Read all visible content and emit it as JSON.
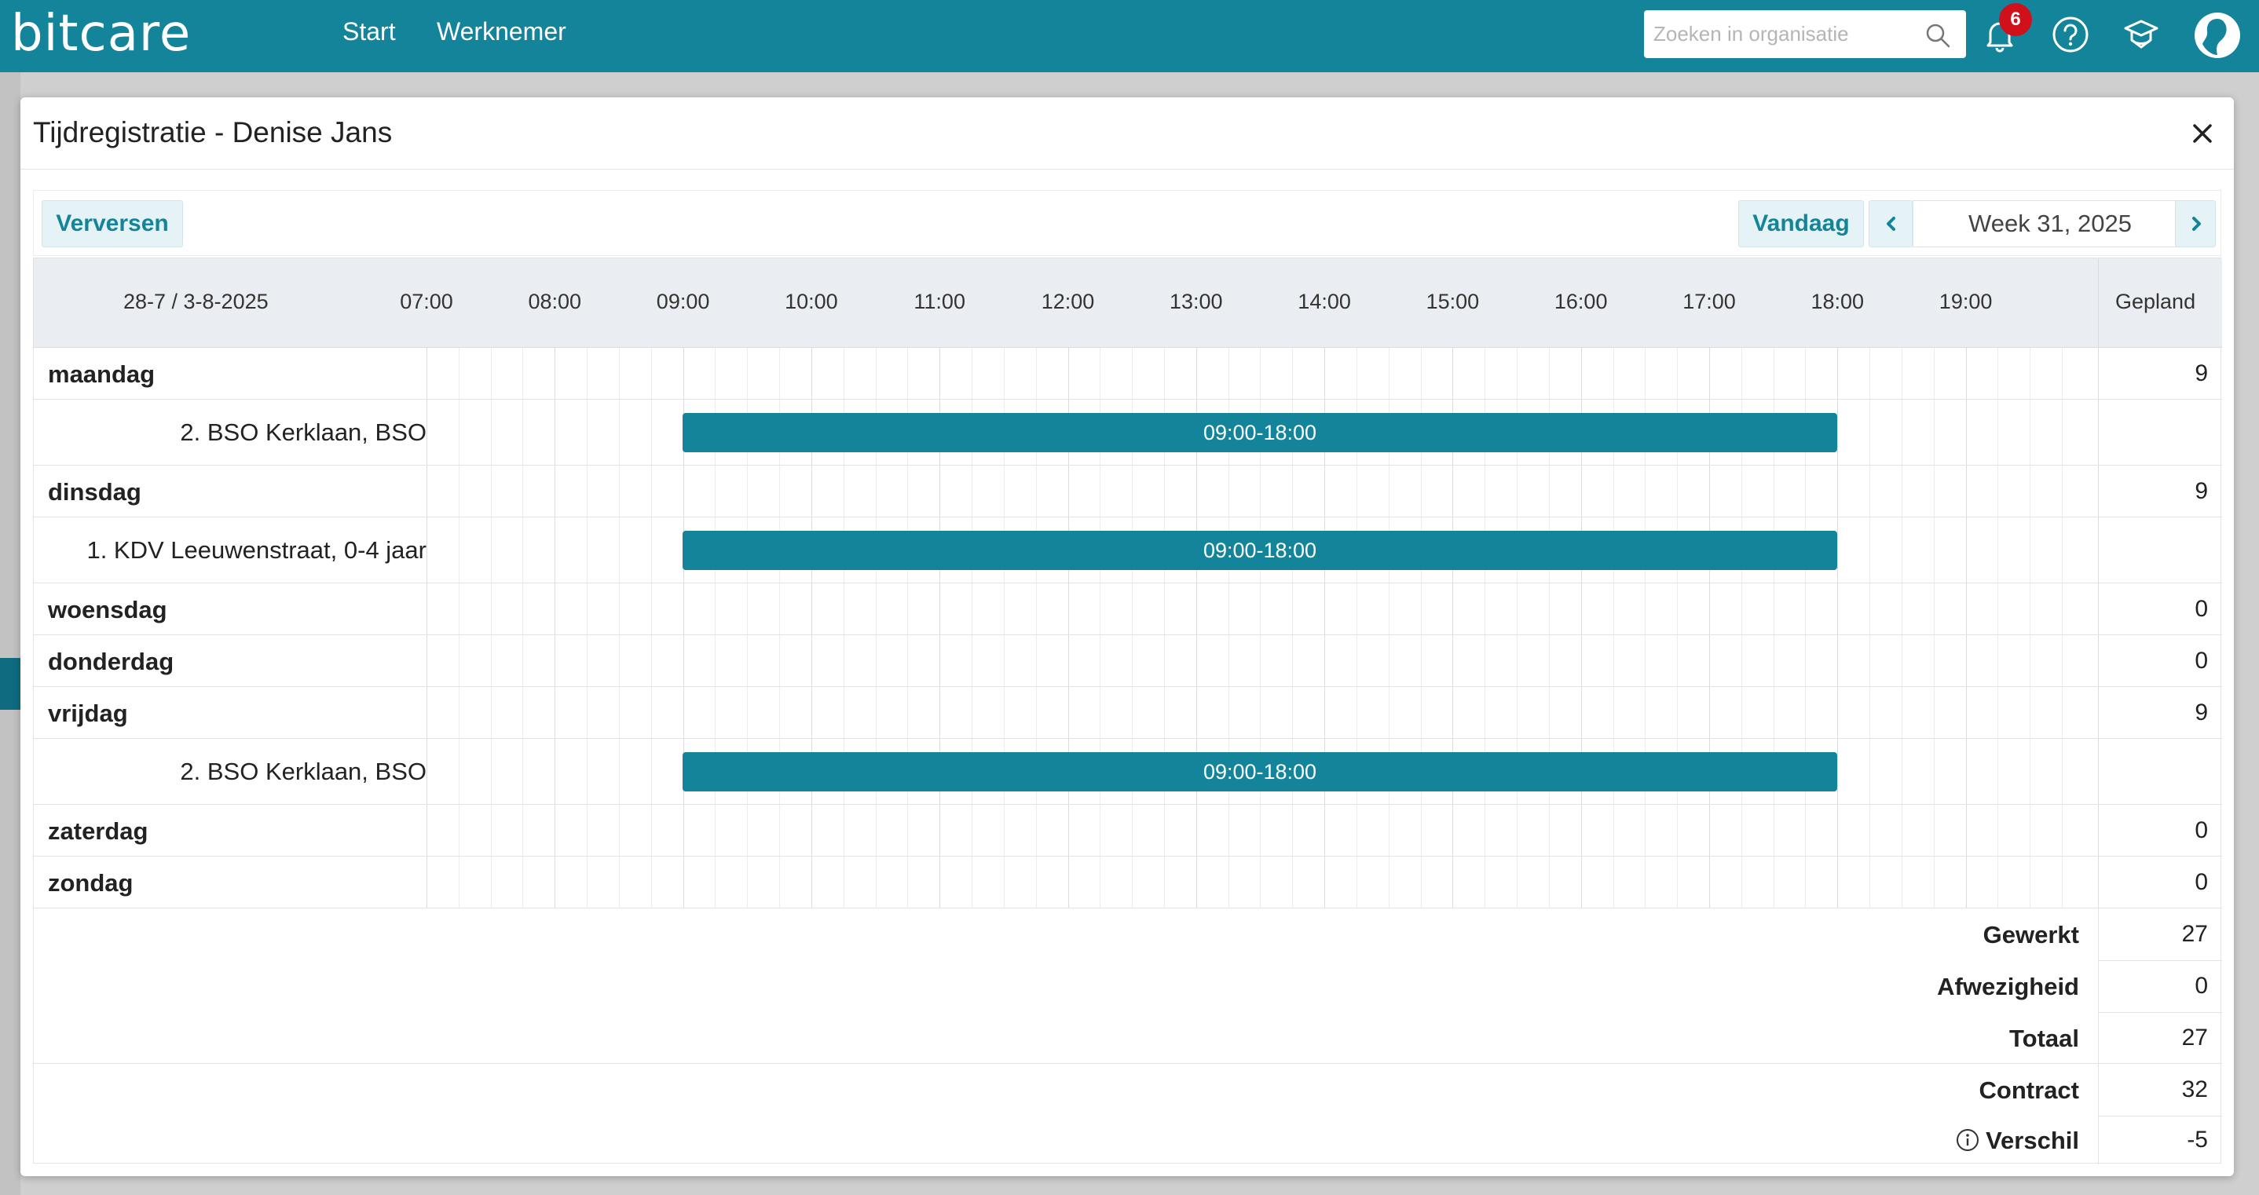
{
  "app": {
    "logo": "bitcare",
    "nav": [
      "Start",
      "Werknemer"
    ],
    "search_placeholder": "Zoeken in organisatie",
    "notification_count": "6",
    "accent_color": "#13849a"
  },
  "modal": {
    "title": "Tijdregistratie - Denise Jans",
    "refresh_label": "Verversen",
    "today_label": "Vandaag",
    "week_label": "Week 31, 2025"
  },
  "grid": {
    "date_range": "28-7 / 3-8-2025",
    "hours": [
      "07:00",
      "08:00",
      "09:00",
      "10:00",
      "11:00",
      "12:00",
      "13:00",
      "14:00",
      "15:00",
      "16:00",
      "17:00",
      "18:00",
      "19:00"
    ],
    "planned_header": "Gepland",
    "days": [
      {
        "name": "maandag",
        "planned": "9",
        "location": "2. BSO Kerklaan, BSO",
        "shift": "09:00-18:00"
      },
      {
        "name": "dinsdag",
        "planned": "9",
        "location": "1. KDV Leeuwenstraat, 0-4 jaar",
        "shift": "09:00-18:00"
      },
      {
        "name": "woensdag",
        "planned": "0"
      },
      {
        "name": "donderdag",
        "planned": "0"
      },
      {
        "name": "vrijdag",
        "planned": "9",
        "location": "2. BSO Kerklaan, BSO",
        "shift": "09:00-18:00"
      },
      {
        "name": "zaterdag",
        "planned": "0"
      },
      {
        "name": "zondag",
        "planned": "0"
      }
    ]
  },
  "summary": {
    "worked_label": "Gewerkt",
    "worked": "27",
    "absence_label": "Afwezigheid",
    "absence": "0",
    "total_label": "Totaal",
    "total": "27",
    "contract_label": "Contract",
    "contract": "32",
    "difference_label": "Verschil",
    "difference": "-5"
  }
}
